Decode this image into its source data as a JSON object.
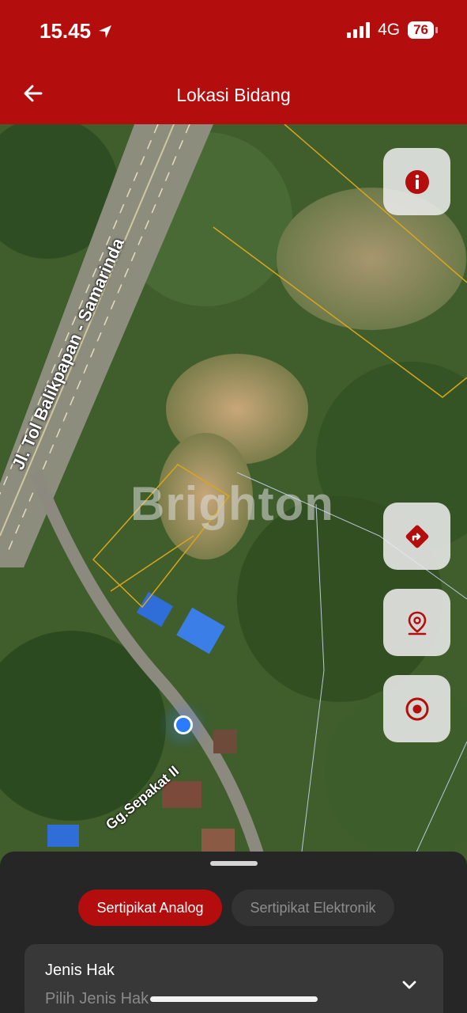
{
  "status_bar": {
    "time": "15.45",
    "network": "4G",
    "battery": "76"
  },
  "header": {
    "title": "Lokasi Bidang",
    "back_icon": "arrow-left-icon"
  },
  "map": {
    "road_main": "Jl. Tol Balikpapan - Samarinda",
    "road_small": "Gg.Sepakat II",
    "watermark": "Brighton",
    "buttons": [
      "info-icon",
      "directions-icon",
      "location-pin-icon",
      "target-icon"
    ]
  },
  "sheet": {
    "tabs": [
      {
        "label": "Sertipikat Analog",
        "active": true
      },
      {
        "label": "Sertipikat Elektronik",
        "active": false
      }
    ],
    "field": {
      "label": "Jenis Hak",
      "placeholder": "Pilih Jenis Hak"
    }
  },
  "colors": {
    "brand": "#b30d0d",
    "sheet": "#262626"
  }
}
